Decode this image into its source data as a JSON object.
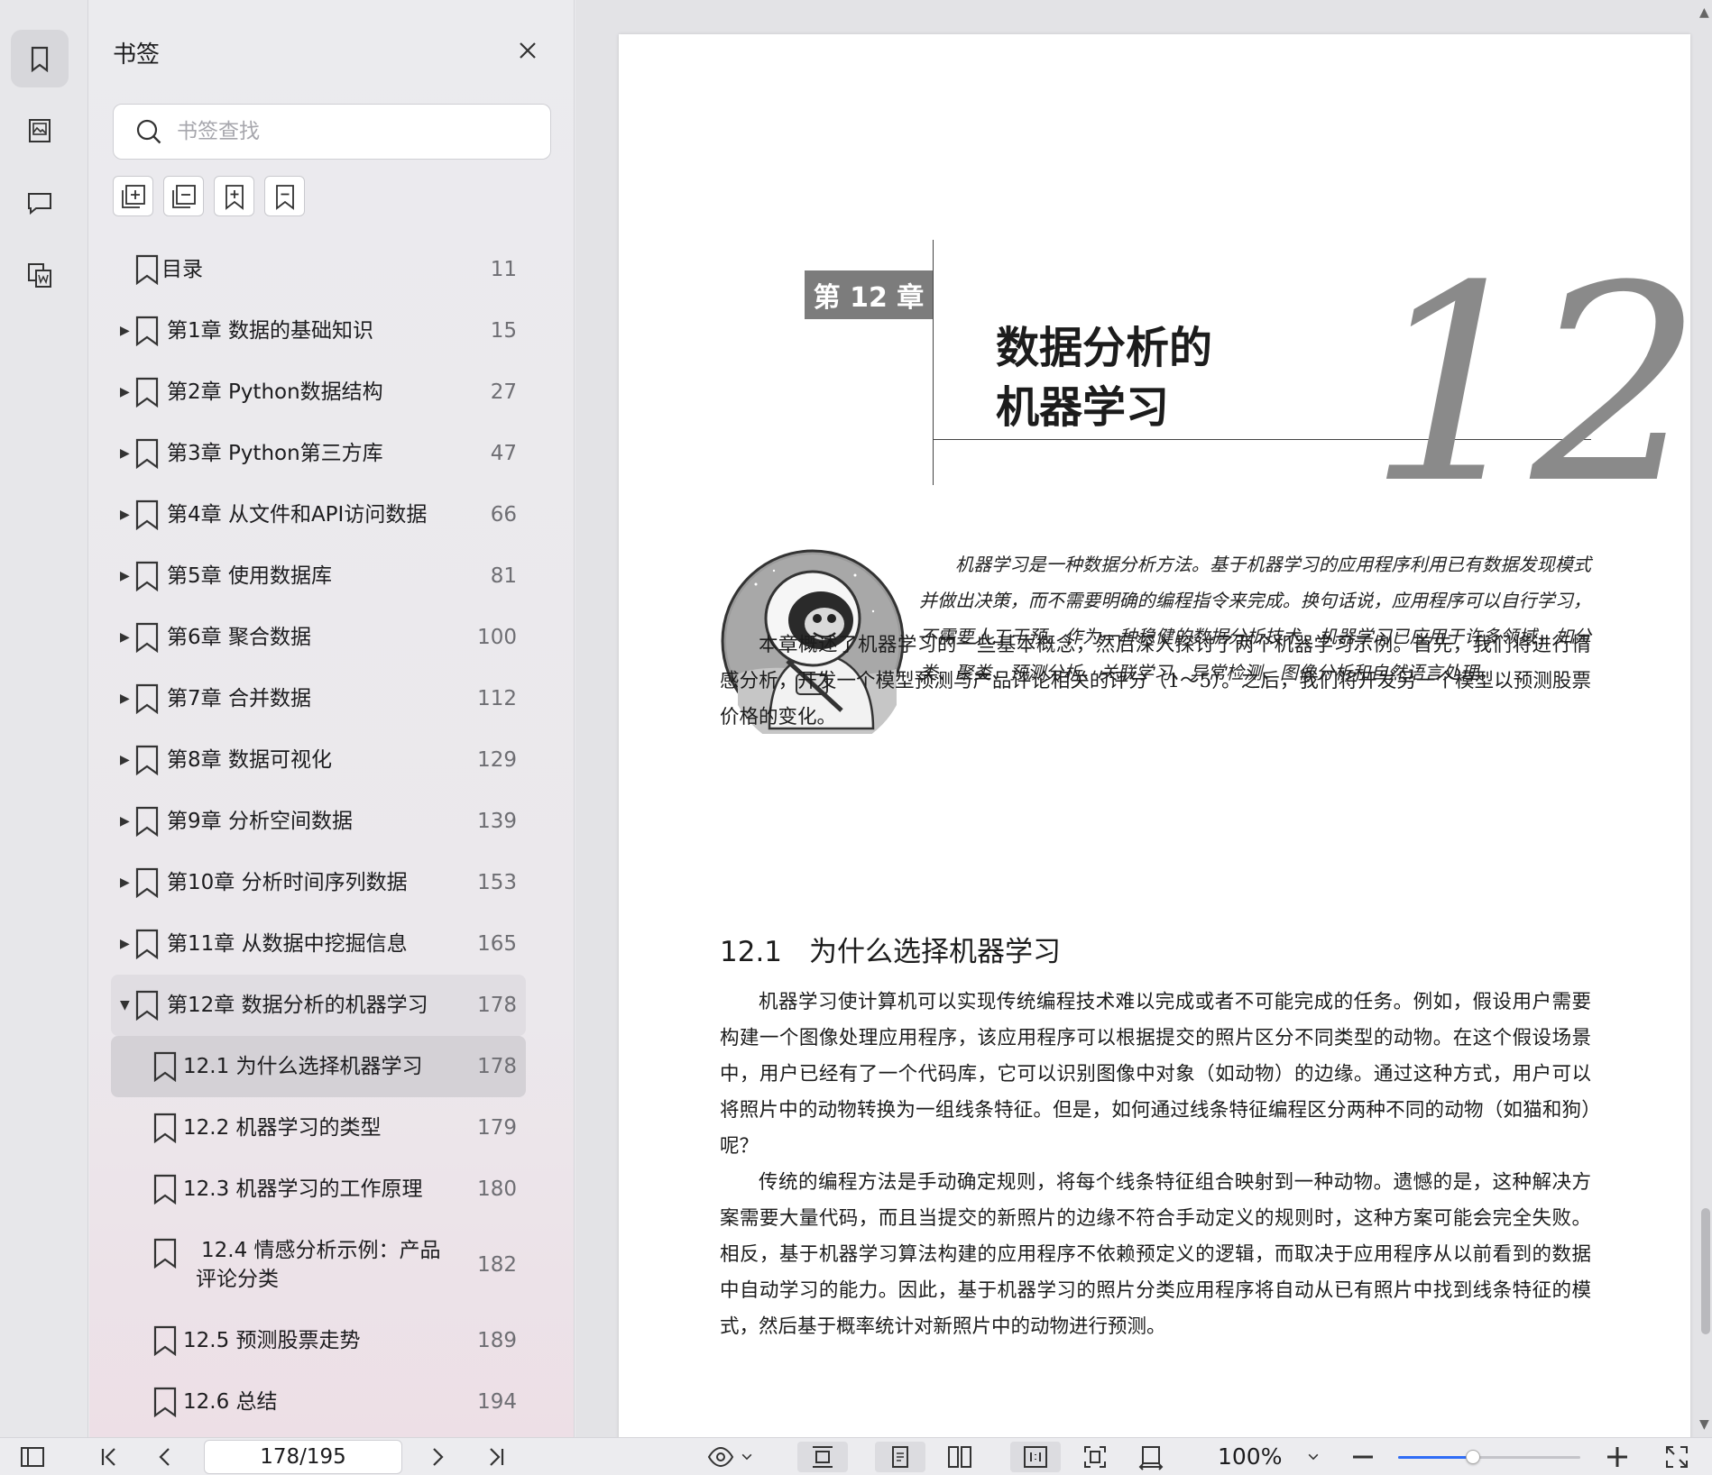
{
  "rail": {
    "items": [
      {
        "icon": "bookmark-icon",
        "active": true
      },
      {
        "icon": "thumbnail-icon",
        "active": false
      },
      {
        "icon": "comment-icon",
        "active": false
      },
      {
        "icon": "attachment-icon",
        "active": false
      }
    ]
  },
  "panel": {
    "title": "书签",
    "search_placeholder": "书签查找",
    "tools": [
      "expand-all-icon",
      "collapse-all-icon",
      "add-bookmark-icon",
      "remove-bookmark-icon"
    ]
  },
  "bookmarks": [
    {
      "label": "目录",
      "page": "11",
      "level": 0,
      "expandable": false
    },
    {
      "label": "第1章 数据的基础知识",
      "page": "15",
      "level": 0,
      "expandable": true
    },
    {
      "label": "第2章 Python数据结构",
      "page": "27",
      "level": 0,
      "expandable": true
    },
    {
      "label": "第3章 Python第三方库",
      "page": "47",
      "level": 0,
      "expandable": true
    },
    {
      "label": "第4章 从文件和API访问数据",
      "page": "66",
      "level": 0,
      "expandable": true
    },
    {
      "label": "第5章 使用数据库",
      "page": "81",
      "level": 0,
      "expandable": true
    },
    {
      "label": "第6章 聚合数据",
      "page": "100",
      "level": 0,
      "expandable": true
    },
    {
      "label": "第7章 合并数据",
      "page": "112",
      "level": 0,
      "expandable": true
    },
    {
      "label": "第8章 数据可视化",
      "page": "129",
      "level": 0,
      "expandable": true
    },
    {
      "label": "第9章 分析空间数据",
      "page": "139",
      "level": 0,
      "expandable": true
    },
    {
      "label": "第10章 分析时间序列数据",
      "page": "153",
      "level": 0,
      "expandable": true
    },
    {
      "label": "第11章 从数据中挖掘信息",
      "page": "165",
      "level": 0,
      "expandable": true
    },
    {
      "label": "第12章 数据分析的机器学习",
      "page": "178",
      "level": 0,
      "expandable": true,
      "expanded": true
    },
    {
      "label": "12.1 为什么选择机器学习",
      "page": "178",
      "level": 1,
      "selected": true
    },
    {
      "label": "12.2 机器学习的类型",
      "page": "179",
      "level": 1
    },
    {
      "label": "12.3 机器学习的工作原理",
      "page": "180",
      "level": 1
    },
    {
      "label": "12.4 情感分析示例：产品评论分类",
      "label_line1": "12.4 情感分析示例：产品",
      "label_line2": "评论分类",
      "page": "182",
      "level": 1
    },
    {
      "label": "12.5 预测股票走势",
      "page": "189",
      "level": 1
    },
    {
      "label": "12.6 总结",
      "page": "194",
      "level": 1
    }
  ],
  "document": {
    "chapter_tag": "第 12 章",
    "chapter_title_line1": "数据分析的",
    "chapter_title_line2": "机器学习",
    "chapter_number": "12",
    "intro": "机器学习是一种数据分析方法。基于机器学习的应用程序利用已有数据发现模式并做出决策，而不需要明确的编程指令来完成。换句话说，应用程序可以自行学习，不需要人工干预。作为一种稳健的数据分析技术，机器学习已应用于许多领域，如分类、聚类、预测分析、关联学习、异常检测、图像分析和自然语言处理。",
    "para1": "本章概述了机器学习的一些基本概念，然后深入探讨了两个机器学习示例。首先，我们将进行情感分析，开发一个模型预测与产品评论相关的评分（1～5）。之后，我们将开发另一个模型以预测股票价格的变化。",
    "section_number": "12.1",
    "section_title": "为什么选择机器学习",
    "para2": "机器学习使计算机可以实现传统编程技术难以完成或者不可能完成的任务。例如，假设用户需要构建一个图像处理应用程序，该应用程序可以根据提交的照片区分不同类型的动物。在这个假设场景中，用户已经有了一个代码库，它可以识别图像中对象（如动物）的边缘。通过这种方式，用户可以将照片中的动物转换为一组线条特征。但是，如何通过线条特征编程区分两种不同的动物（如猫和狗）呢？",
    "para3": "传统的编程方法是手动确定规则，将每个线条特征组合映射到一种动物。遗憾的是，这种解决方案需要大量代码，而且当提交的新照片的边缘不符合手动定义的规则时，这种方案可能会完全失败。相反，基于机器学习算法构建的应用程序不依赖预定义的逻辑，而取决于应用程序从以前看到的数据中自动学习的能力。因此，基于机器学习的照片分类应用程序将自动从已有照片中找到线条特征的模式，然后基于概率统计对新照片中的动物进行预测。"
  },
  "toolbar": {
    "page_indicator": "178/195",
    "zoom": "100%",
    "zoom_fraction": 0.41
  },
  "colors": {
    "accent": "#2f6df6",
    "chapter_tag_bg": "#7c7c7c",
    "chapter_number": "#8a8a8a"
  }
}
